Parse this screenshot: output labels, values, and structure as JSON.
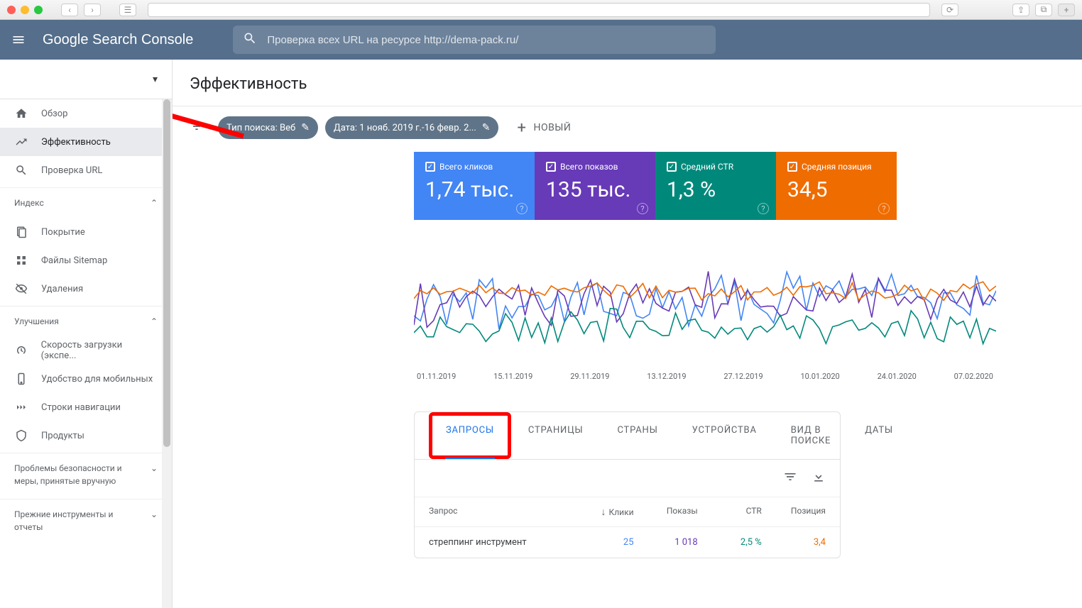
{
  "header": {
    "logo_html": "Google Search Console",
    "search_placeholder": "Проверка всех URL на ресурсе http://dema-pack.ru/"
  },
  "sidebar": {
    "items": [
      {
        "icon": "home",
        "label": "Обзор"
      },
      {
        "icon": "trend",
        "label": "Эффективность",
        "active": true
      },
      {
        "icon": "search",
        "label": "Проверка URL"
      }
    ],
    "section_index": "Индекс",
    "index_items": [
      {
        "icon": "pages",
        "label": "Покрытие"
      },
      {
        "icon": "sitemap",
        "label": "Файлы Sitemap"
      },
      {
        "icon": "remove",
        "label": "Удаления"
      }
    ],
    "section_enh": "Улучшения",
    "enh_items": [
      {
        "icon": "speed",
        "label": "Скорость загрузки (экспе..."
      },
      {
        "icon": "mobile",
        "label": "Удобство для мобильных"
      },
      {
        "icon": "bread",
        "label": "Строки навигации"
      },
      {
        "icon": "product",
        "label": "Продукты"
      }
    ],
    "section_security": "Проблемы безопасности и меры, принятые вручную",
    "section_legacy": "Прежние инструменты и отчеты"
  },
  "page": {
    "title": "Эффективность",
    "chip_type": "Тип поиска: Веб",
    "chip_date": "Дата: 1 нояб. 2019 г.-16 февр. 2...",
    "new_label": "НОВЫЙ"
  },
  "metrics": {
    "clicks": {
      "label": "Всего кликов",
      "value": "1,74 тыс."
    },
    "impressions": {
      "label": "Всего показов",
      "value": "135 тыс."
    },
    "ctr": {
      "label": "Средний CTR",
      "value": "1,3 %"
    },
    "position": {
      "label": "Средняя позиция",
      "value": "34,5"
    }
  },
  "chart_data": {
    "type": "line",
    "x_categories": [
      "01.11.2019",
      "15.11.2019",
      "29.11.2019",
      "13.12.2019",
      "27.12.2019",
      "10.01.2020",
      "24.01.2020",
      "07.02.2020"
    ],
    "series": [
      {
        "name": "Всего кликов",
        "color": "#4285f4"
      },
      {
        "name": "Всего показов",
        "color": "#673ab7"
      },
      {
        "name": "Средний CTR",
        "color": "#00897b"
      },
      {
        "name": "Средняя позиция",
        "color": "#ef6c00"
      }
    ]
  },
  "tabs": [
    "ЗАПРОСЫ",
    "СТРАНИЦЫ",
    "СТРАНЫ",
    "УСТРОЙСТВА",
    "ВИД В ПОИСКЕ",
    "ДАТЫ"
  ],
  "table": {
    "columns": {
      "query": "Запрос",
      "clicks": "Клики",
      "imp": "Показы",
      "ctr": "CTR",
      "pos": "Позиция"
    },
    "rows": [
      {
        "query": "стреппинг инструмент",
        "clicks": "25",
        "imp": "1 018",
        "ctr": "2,5 %",
        "pos": "3,4"
      }
    ]
  }
}
